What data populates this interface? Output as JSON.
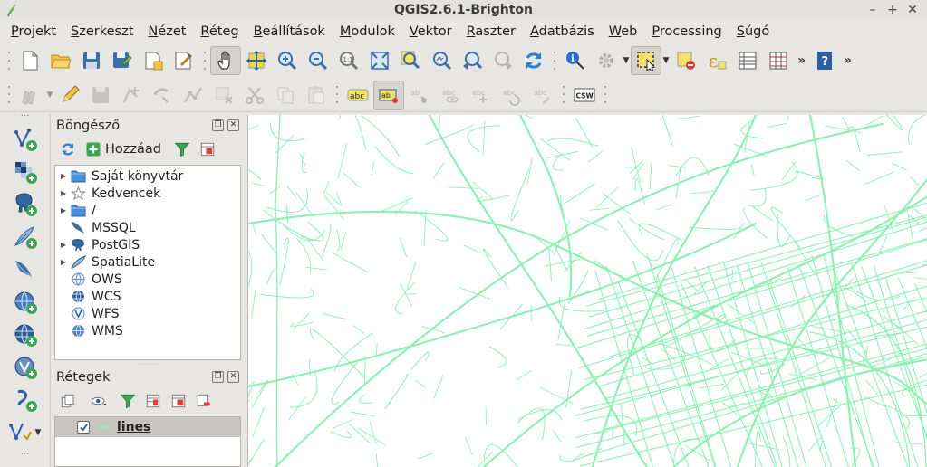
{
  "window": {
    "title": "QGIS2.6.1-Brighton",
    "controls": [
      "–",
      "+",
      "✕"
    ]
  },
  "menubar": {
    "items": [
      {
        "label": "Projekt",
        "u": "P"
      },
      {
        "label": "Szerkeszt",
        "u": "S"
      },
      {
        "label": "Nézet",
        "u": "N"
      },
      {
        "label": "Réteg",
        "u": "R"
      },
      {
        "label": "Beállítások",
        "u": "B"
      },
      {
        "label": "Modulok",
        "u": "M"
      },
      {
        "label": "Vektor",
        "u": "V"
      },
      {
        "label": "Raszter",
        "u": "R"
      },
      {
        "label": "Adatbázis",
        "u": "A"
      },
      {
        "label": "Web",
        "u": "W"
      },
      {
        "label": "Processing",
        "u": "P"
      },
      {
        "label": "Súgó",
        "u": "S"
      }
    ]
  },
  "toolbar_labels": {
    "abc": "abc",
    "csw": "CSW",
    "more": "»"
  },
  "browser": {
    "title": "Böngésző",
    "add_label": "Hozzáad",
    "items": [
      {
        "label": "Saját könyvtár",
        "icon": "folder-icon",
        "expandable": true
      },
      {
        "label": "Kedvencek",
        "icon": "star-icon",
        "expandable": true
      },
      {
        "label": "/",
        "icon": "folder-icon",
        "expandable": true
      },
      {
        "label": "MSSQL",
        "icon": "mssql-icon",
        "expandable": false
      },
      {
        "label": "PostGIS",
        "icon": "postgis-elephant-icon",
        "expandable": true
      },
      {
        "label": "SpatiaLite",
        "icon": "spatialite-feather-icon",
        "expandable": true
      },
      {
        "label": "OWS",
        "icon": "ows-globe-icon",
        "expandable": false
      },
      {
        "label": "WCS",
        "icon": "wcs-globe-icon",
        "expandable": false
      },
      {
        "label": "WFS",
        "icon": "wfs-globe-icon",
        "expandable": false
      },
      {
        "label": "WMS",
        "icon": "wms-globe-icon",
        "expandable": false
      }
    ]
  },
  "layers": {
    "title": "Rétegek",
    "items": [
      {
        "name": "lines",
        "visible": true
      }
    ]
  },
  "colors": {
    "road_lines": "#8ff0b4",
    "folder": "#4a90d9",
    "accent_green": "#3aa655"
  }
}
